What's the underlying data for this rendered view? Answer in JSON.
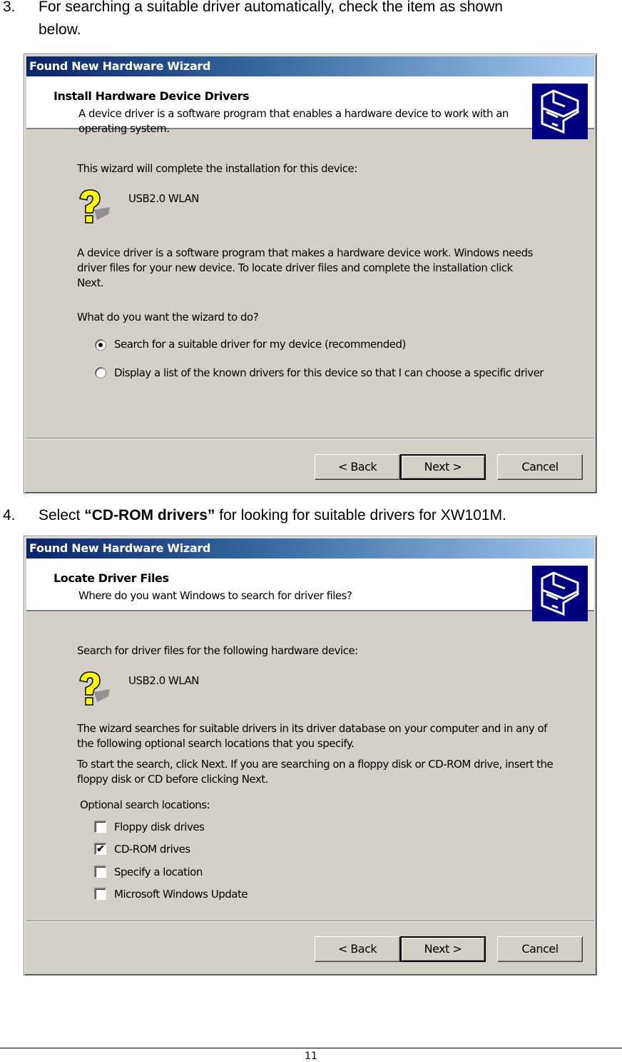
{
  "steps": [
    {
      "number": "3.",
      "text_line1": "For searching a suitable driver automatically, check the item as shown",
      "text_line2": "below."
    },
    {
      "number": "4.",
      "prefix": "Select ",
      "bold": "“CD-ROM drivers”",
      "suffix": " for looking for suitable drivers for XW101M."
    }
  ],
  "wizard1": {
    "title": "Found New Hardware Wizard",
    "header_title": "Install Hardware Device Drivers",
    "header_subtitle": "A device driver is a software program that enables a hardware device to work with an operating system.",
    "intro": "This wizard will complete the installation for this device:",
    "device_name": "USB2.0 WLAN",
    "description": "A device driver is a software program that makes a hardware device work. Windows needs driver files for your new device. To locate driver files and complete the installation click Next.",
    "question": "What do you want the wizard to do?",
    "options": [
      {
        "label": "Search for a suitable driver for my device (recommended)",
        "selected": true
      },
      {
        "label": "Display a list of the known drivers for this device so that I can choose a specific driver",
        "selected": false
      }
    ],
    "buttons": {
      "back": "< Back",
      "next": "Next >",
      "cancel": "Cancel"
    }
  },
  "wizard2": {
    "title": "Found New Hardware Wizard",
    "header_title": "Locate Driver Files",
    "header_subtitle": "Where do you want Windows to search for driver files?",
    "intro": "Search for driver files for the following hardware device:",
    "device_name": "USB2.0 WLAN",
    "description1": "The wizard searches for suitable drivers in its driver database on your computer and in any of the following optional search locations that you specify.",
    "description2": "To start the search, click Next. If you are searching on a floppy disk or CD-ROM drive, insert the floppy disk or CD before clicking Next.",
    "optional_label": "Optional search locations:",
    "locations": [
      {
        "label": "Floppy disk drives",
        "checked": false
      },
      {
        "label": "CD-ROM drives",
        "checked": true
      },
      {
        "label": "Specify a location",
        "checked": false
      },
      {
        "label": "Microsoft Windows Update",
        "checked": false
      }
    ],
    "check_mark": "✔",
    "buttons": {
      "back": "< Back",
      "next": "Next >",
      "cancel": "Cancel"
    }
  },
  "footer": {
    "page_number": "11"
  }
}
